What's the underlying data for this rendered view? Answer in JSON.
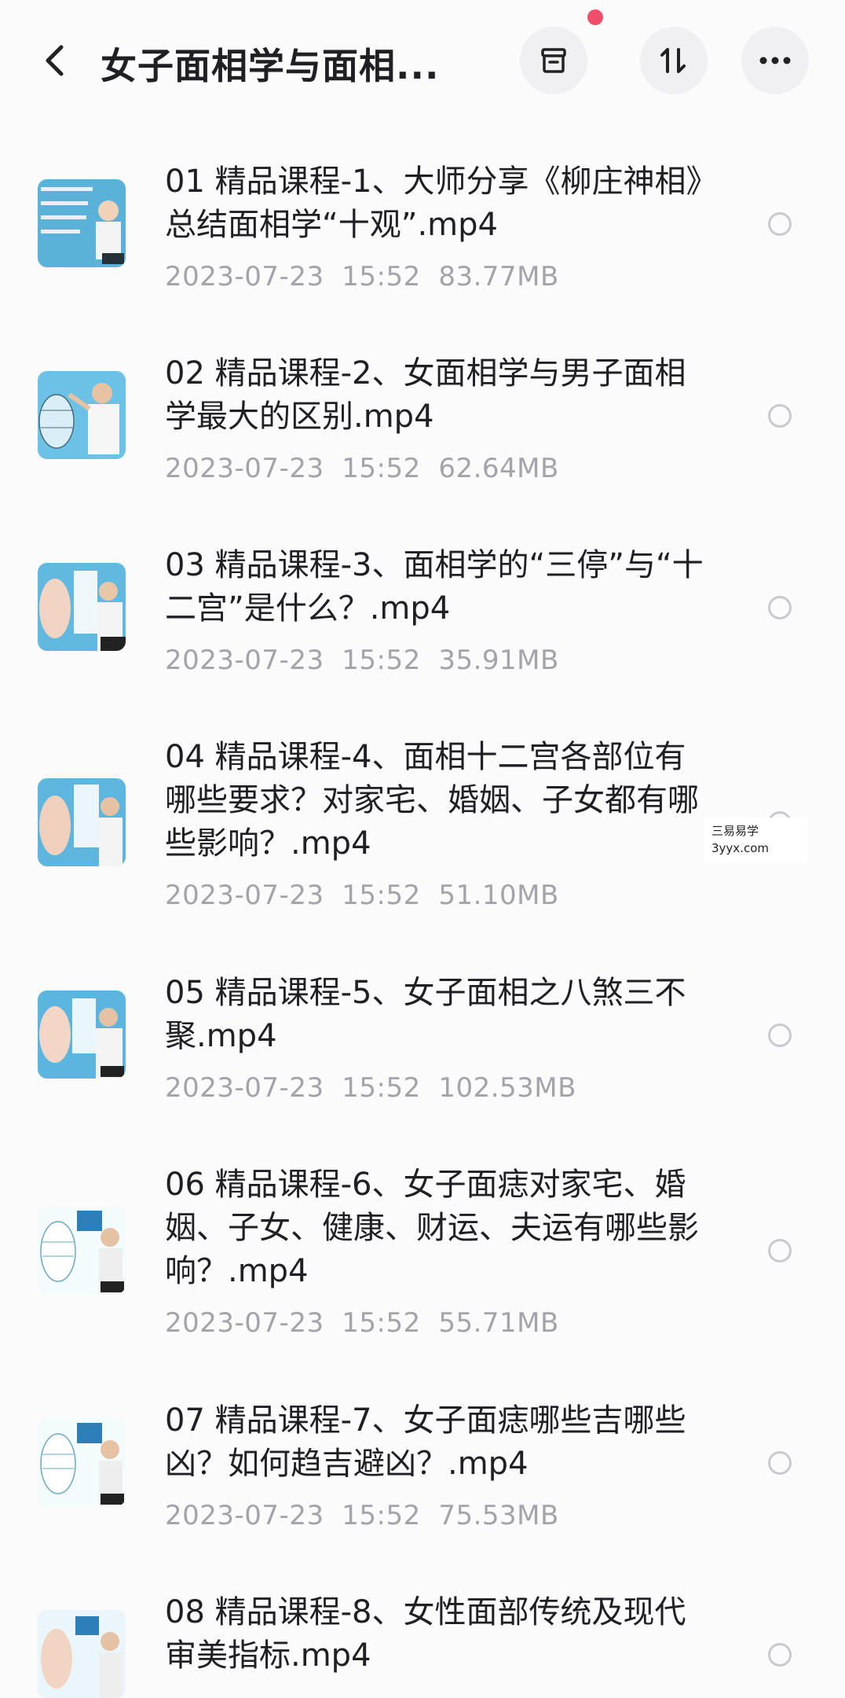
{
  "header": {
    "title": "女子面相学与面相...",
    "back_icon": "chevron-left-icon",
    "archive_icon": "archive-box-icon",
    "sort_icon": "sort-arrows-icon",
    "more_icon": "more-horizontal-icon",
    "notification_color": "#ef4f6b"
  },
  "files": [
    {
      "name": "01 精品课程-1、大师分享《柳庄神相》总结面相学“十观”.mp4",
      "date": "2023-07-23",
      "time": "15:52",
      "size": "83.77MB"
    },
    {
      "name": "02 精品课程-2、女面相学与男子面相学最大的区别.mp4",
      "date": "2023-07-23",
      "time": "15:52",
      "size": "62.64MB"
    },
    {
      "name": "03 精品课程-3、面相学的“三停”与“十二宫”是什么？.mp4",
      "date": "2023-07-23",
      "time": "15:52",
      "size": "35.91MB"
    },
    {
      "name": "04 精品课程-4、面相十二宫各部位有哪些要求？对家宅、婚姻、子女都有哪些影响？.mp4",
      "date": "2023-07-23",
      "time": "15:52",
      "size": "51.10MB"
    },
    {
      "name": "05 精品课程-5、女子面相之八煞三不聚.mp4",
      "date": "2023-07-23",
      "time": "15:52",
      "size": "102.53MB"
    },
    {
      "name": "06 精品课程-6、女子面痣对家宅、婚姻、子女、健康、财运、夫运有哪些影响？.mp4",
      "date": "2023-07-23",
      "time": "15:52",
      "size": "55.71MB"
    },
    {
      "name": "07 精品课程-7、女子面痣哪些吉哪些凶？如何趋吉避凶？.mp4",
      "date": "2023-07-23",
      "time": "15:52",
      "size": "75.53MB"
    },
    {
      "name": "08 精品课程-8、女性面部传统及现代审美指标.mp4"
    }
  ],
  "watermark": {
    "line1": "三易易学",
    "line2": "3yyx.com"
  }
}
